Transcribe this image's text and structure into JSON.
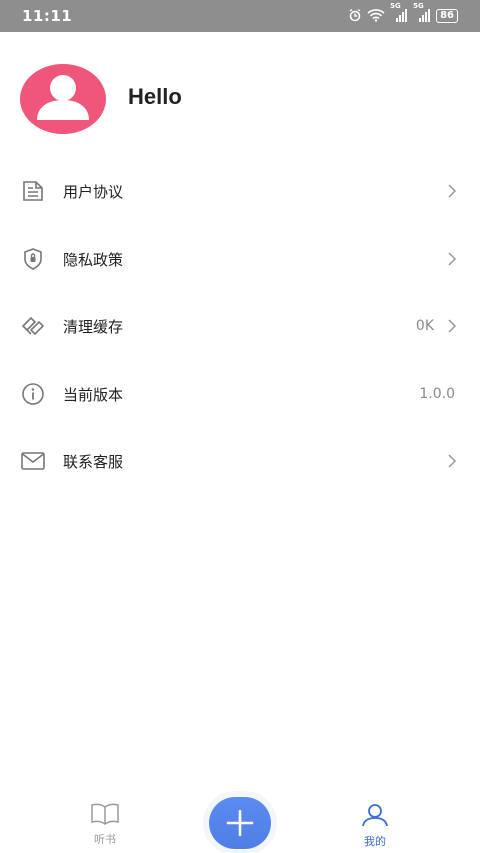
{
  "status_bar": {
    "time": "11:11",
    "battery": "86",
    "icons": [
      "alarm-icon",
      "wifi-icon",
      "signal-5g-icon",
      "signal-5g-icon",
      "battery-icon"
    ],
    "signal_tag_1": "5G",
    "signal_tag_2": "5G"
  },
  "profile": {
    "avatar_color": "#f0567a",
    "greeting": "Hello"
  },
  "menu": {
    "items": [
      {
        "label": "用户协议",
        "value": "",
        "icon": "document-icon"
      },
      {
        "label": "隐私政策",
        "value": "",
        "icon": "shield-icon"
      },
      {
        "label": "清理缓存",
        "value": "0K",
        "icon": "broom-icon"
      },
      {
        "label": "当前版本",
        "value": "1.0.0",
        "icon": "info-icon"
      },
      {
        "label": "联系客服",
        "value": "",
        "icon": "mail-icon"
      }
    ]
  },
  "tabbar": {
    "tabs": [
      {
        "label": "听书",
        "icon": "book-icon",
        "active": false
      },
      {
        "label": "我的",
        "icon": "user-icon",
        "active": true
      }
    ],
    "fab_icon": "plus-icon",
    "accent_color": "#3c6bd8"
  }
}
